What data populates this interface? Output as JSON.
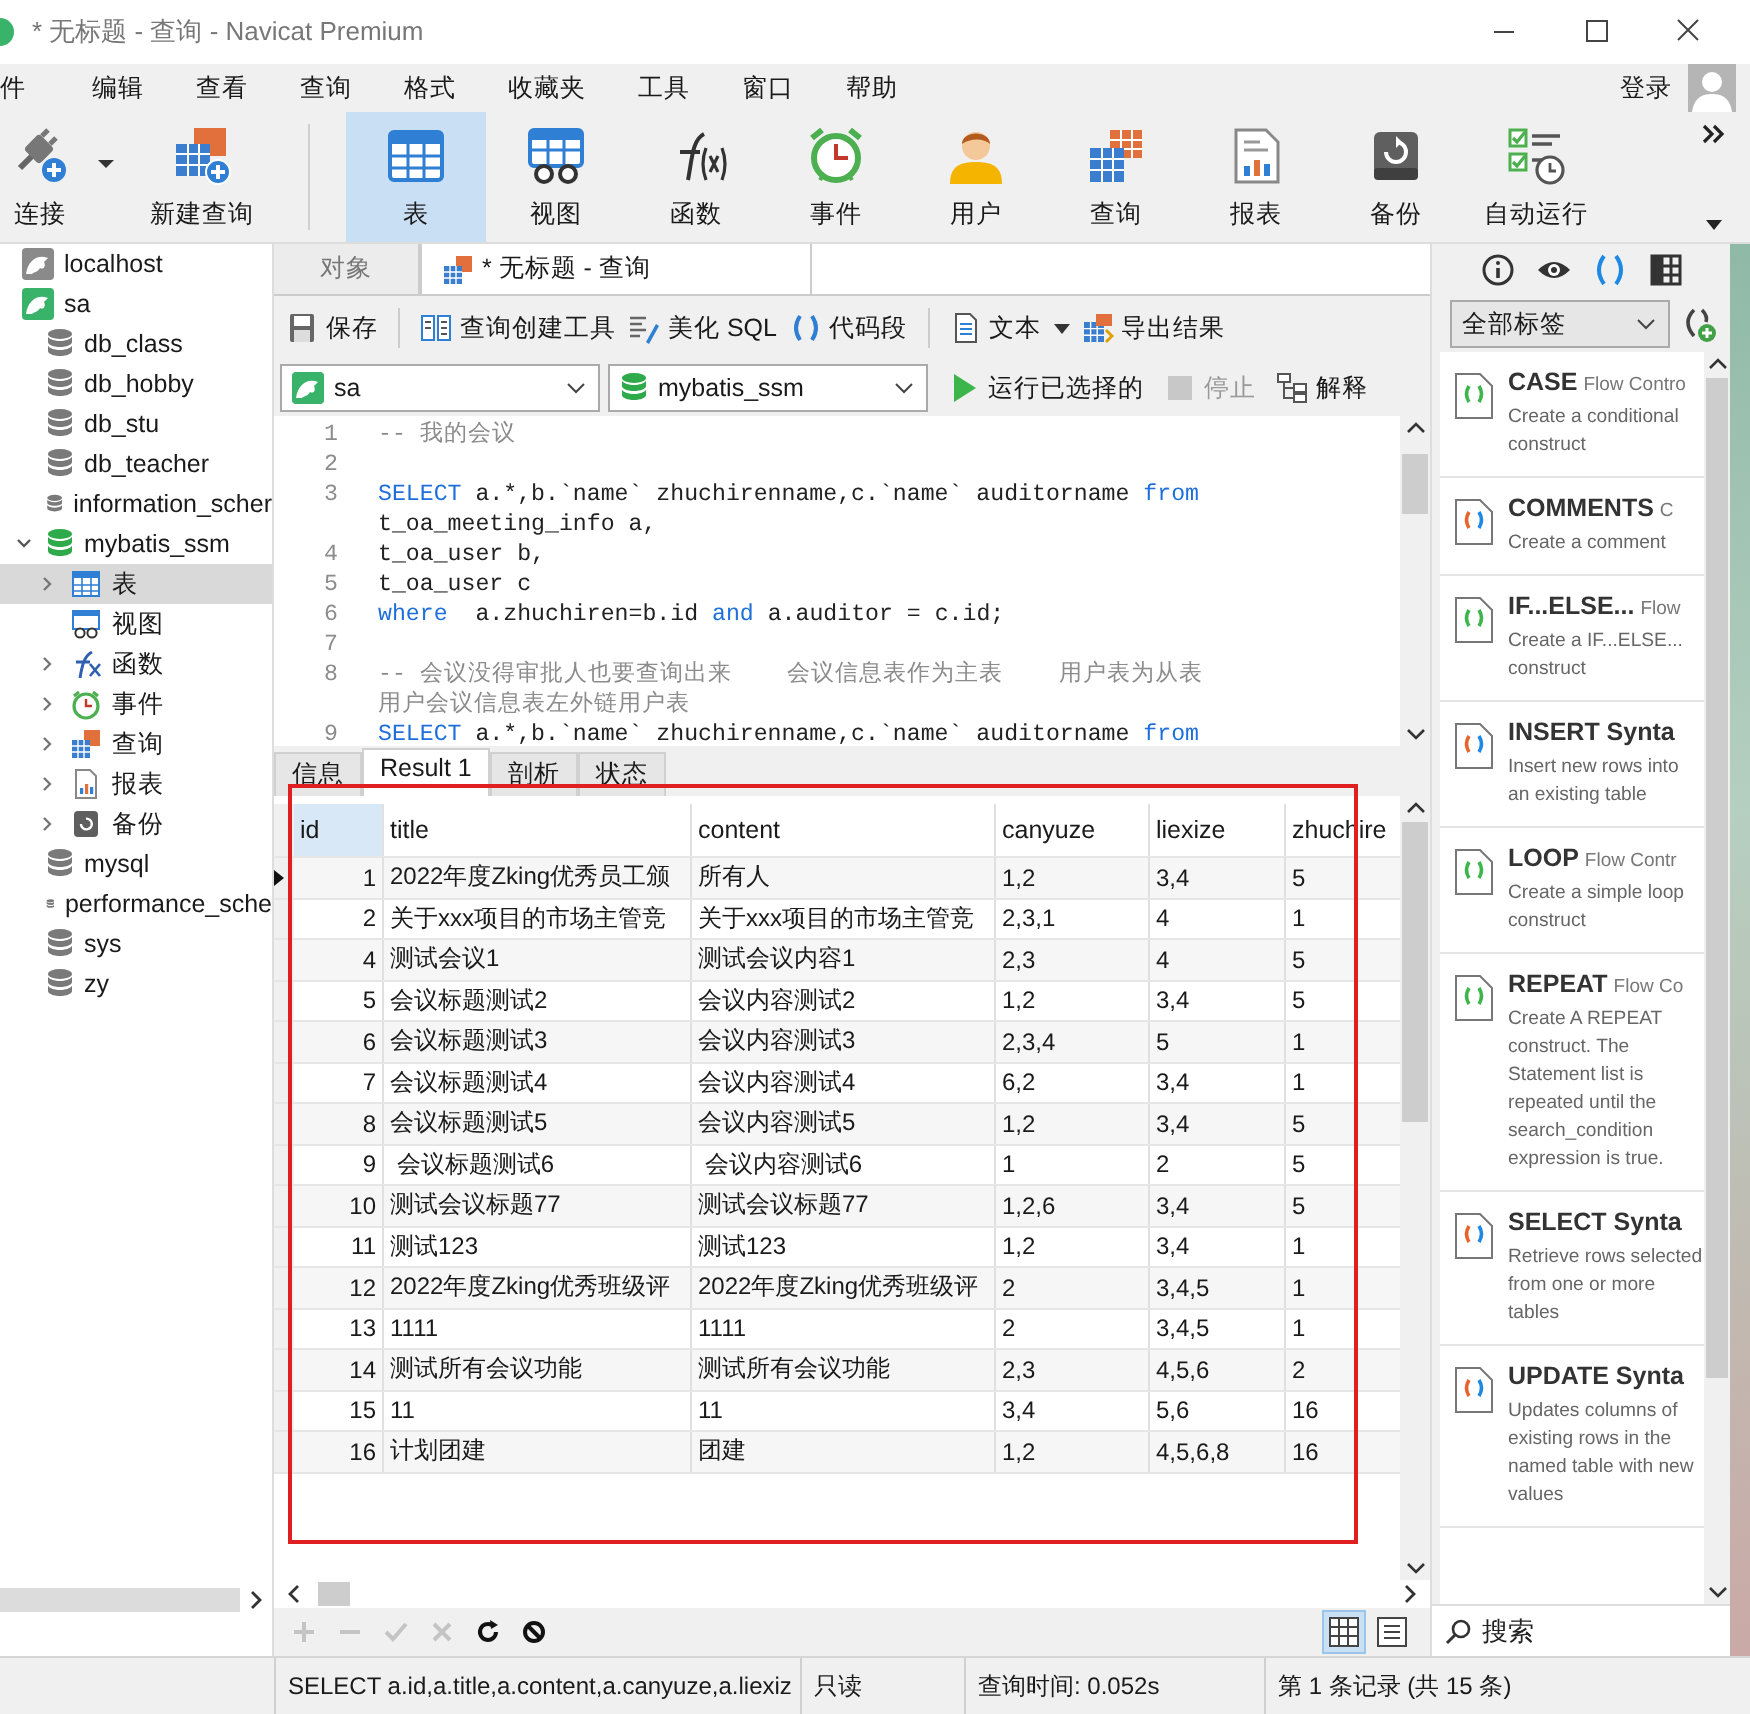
{
  "window": {
    "title": "* 无标题 - 查询 - Navicat Premium"
  },
  "menu": {
    "items": [
      "件",
      "编辑",
      "查看",
      "查询",
      "格式",
      "收藏夹",
      "工具",
      "窗口",
      "帮助"
    ],
    "login": "登录"
  },
  "toolbar": [
    {
      "kind": "connect",
      "label": "连接",
      "selected": false
    },
    {
      "kind": "newquery",
      "label": "新建查询",
      "selected": false
    },
    {
      "kind": "table",
      "label": "表",
      "selected": true
    },
    {
      "kind": "view",
      "label": "视图",
      "selected": false
    },
    {
      "kind": "function",
      "label": "函数",
      "selected": false
    },
    {
      "kind": "event",
      "label": "事件",
      "selected": false
    },
    {
      "kind": "user",
      "label": "用户",
      "selected": false
    },
    {
      "kind": "query",
      "label": "查询",
      "selected": false
    },
    {
      "kind": "report",
      "label": "报表",
      "selected": false
    },
    {
      "kind": "backup",
      "label": "备份",
      "selected": false
    },
    {
      "kind": "autorun",
      "label": "自动运行",
      "selected": false
    }
  ],
  "sidebar": {
    "tree": [
      {
        "kind": "connection",
        "label": "localhost",
        "open": false,
        "selected": false
      },
      {
        "kind": "connection",
        "label": "sa",
        "open": true,
        "selected": false,
        "children": [
          {
            "kind": "database",
            "label": "db_class",
            "open": false,
            "selected": false
          },
          {
            "kind": "database",
            "label": "db_hobby",
            "open": false,
            "selected": false
          },
          {
            "kind": "database",
            "label": "db_stu",
            "open": false,
            "selected": false
          },
          {
            "kind": "database",
            "label": "db_teacher",
            "open": false,
            "selected": false
          },
          {
            "kind": "database",
            "label": "information_scher",
            "open": false,
            "selected": false
          },
          {
            "kind": "database",
            "label": "mybatis_ssm",
            "open": true,
            "expanded": true,
            "selected": false,
            "children": [
              {
                "kind": "table",
                "label": "表",
                "expanded": false,
                "selected": true
              },
              {
                "kind": "view",
                "label": "视图",
                "selected": false
              },
              {
                "kind": "function",
                "label": "函数",
                "expanded": false,
                "selected": false
              },
              {
                "kind": "event",
                "label": "事件",
                "expanded": false,
                "selected": false
              },
              {
                "kind": "query",
                "label": "查询",
                "expanded": false,
                "selected": false
              },
              {
                "kind": "report",
                "label": "报表",
                "expanded": false,
                "selected": false
              },
              {
                "kind": "backup",
                "label": "备份",
                "expanded": false,
                "selected": false
              }
            ]
          },
          {
            "kind": "database",
            "label": "mysql",
            "open": false,
            "selected": false
          },
          {
            "kind": "database",
            "label": "performance_sche",
            "open": false,
            "selected": false
          },
          {
            "kind": "database",
            "label": "sys",
            "open": false,
            "selected": false
          },
          {
            "kind": "database",
            "label": "zy",
            "open": false,
            "selected": false
          }
        ]
      }
    ]
  },
  "tabs": [
    {
      "label": "对象",
      "kind": "objects",
      "selected": false
    },
    {
      "label": "* 无标题 - 查询",
      "kind": "query",
      "selected": true
    }
  ],
  "editor_toolbar": [
    [
      {
        "kind": "save",
        "label": "保存"
      }
    ],
    [
      {
        "kind": "builder",
        "label": "查询创建工具"
      },
      {
        "kind": "beautify",
        "label": "美化 SQL"
      },
      {
        "kind": "snippet",
        "label": "代码段"
      }
    ],
    [
      {
        "kind": "text",
        "label": "文本"
      },
      {
        "kind": "export",
        "label": "导出结果"
      }
    ]
  ],
  "run_bar": {
    "connection": "sa",
    "database": "mybatis_ssm",
    "actions": [
      {
        "kind": "run",
        "label": "运行已选择的",
        "disabled": false
      },
      {
        "kind": "stop",
        "label": "停止",
        "disabled": true
      },
      {
        "kind": "explain",
        "label": "解释",
        "disabled": false
      }
    ]
  },
  "editor": {
    "lines": [
      {
        "number": "1",
        "tokens": [
          {
            "kind": "comment",
            "text": "-- 我的会议"
          }
        ]
      },
      {
        "number": "2"
      },
      {
        "number": "3",
        "tokens": [
          {
            "kind": "keyword",
            "text": "SELECT"
          },
          {
            "kind": "plain",
            "text": " a.*,b.`name` zhuchirenname,c.`name` auditorname "
          },
          {
            "kind": "keyword",
            "text": "from"
          },
          {
            "kind": "plain",
            "text": " t_oa_meeting_info a,"
          }
        ]
      },
      {
        "number": "4",
        "tokens": [
          {
            "kind": "plain",
            "text": "t_oa_user b,"
          }
        ]
      },
      {
        "number": "5",
        "tokens": [
          {
            "kind": "plain",
            "text": "t_oa_user c"
          }
        ]
      },
      {
        "number": "6",
        "tokens": [
          {
            "kind": "keyword",
            "text": "where"
          },
          {
            "kind": "plain",
            "text": "  a.zhuchiren=b.id "
          },
          {
            "kind": "keyword",
            "text": "and"
          },
          {
            "kind": "plain",
            "text": " a.auditor = c.id;"
          }
        ]
      },
      {
        "number": "7"
      },
      {
        "number": "8",
        "tokens": [
          {
            "kind": "comment",
            "text": "-- 会议没得审批人也要查询出来    会议信息表作为主表    用户表为从表"
          },
          {
            "kind": "break"
          },
          {
            "kind": "comment",
            "text": "用户会议信息表左外链用户表"
          }
        ]
      },
      {
        "number": "9",
        "tokens": [
          {
            "kind": "keyword",
            "text": "SELECT"
          },
          {
            "kind": "plain",
            "text": " a.*,b.`name` zhuchirenname,c.`name` auditorname "
          },
          {
            "kind": "keyword",
            "text": "from"
          }
        ]
      }
    ]
  },
  "result_tabs": [
    {
      "label": "信息",
      "selected": false
    },
    {
      "label": "Result 1",
      "selected": true
    },
    {
      "label": "剖析",
      "selected": false
    },
    {
      "label": "状态",
      "selected": false
    }
  ],
  "grid": {
    "highlight_box": true,
    "columns": [
      {
        "label": "id",
        "selected": true
      },
      {
        "label": "title",
        "selected": false
      },
      {
        "label": "content",
        "selected": false
      },
      {
        "label": "canyuze",
        "selected": false
      },
      {
        "label": "liexize",
        "selected": false
      },
      {
        "label": "zhuchire",
        "selected": false
      }
    ],
    "rows": [
      {
        "current": true,
        "cells": [
          "1",
          "2022年度Zking优秀员工颁",
          "所有人",
          "1,2",
          "3,4",
          "5"
        ]
      },
      {
        "current": false,
        "cells": [
          "2",
          "关于xxx项目的市场主管竞",
          "关于xxx项目的市场主管竞",
          "2,3,1",
          "4",
          "1"
        ]
      },
      {
        "current": false,
        "cells": [
          "4",
          "测试会议1",
          "测试会议内容1",
          "2,3",
          "4",
          "5"
        ]
      },
      {
        "current": false,
        "cells": [
          "5",
          "会议标题测试2",
          "会议内容测试2",
          "1,2",
          "3,4",
          "5"
        ]
      },
      {
        "current": false,
        "cells": [
          "6",
          "会议标题测试3",
          "会议内容测试3",
          "2,3,4",
          "5",
          "1"
        ]
      },
      {
        "current": false,
        "cells": [
          "7",
          "会议标题测试4",
          "会议内容测试4",
          "6,2",
          "3,4",
          "1"
        ]
      },
      {
        "current": false,
        "cells": [
          "8",
          "会议标题测试5",
          "会议内容测试5",
          "1,2",
          "3,4",
          "5"
        ]
      },
      {
        "current": false,
        "cells": [
          "9",
          " 会议标题测试6",
          " 会议内容测试6",
          "1",
          "2",
          "5"
        ]
      },
      {
        "current": false,
        "cells": [
          "10",
          "测试会议标题77",
          "测试会议标题77",
          "1,2,6",
          "3,4",
          "5"
        ]
      },
      {
        "current": false,
        "cells": [
          "11",
          "测试123",
          "测试123",
          "1,2",
          "3,4",
          "1"
        ]
      },
      {
        "current": false,
        "cells": [
          "12",
          "2022年度Zking优秀班级评",
          "2022年度Zking优秀班级评",
          "2",
          "3,4,5",
          "1"
        ]
      },
      {
        "current": false,
        "cells": [
          "13",
          "1111",
          "1111",
          "2",
          "3,4,5",
          "1"
        ]
      },
      {
        "current": false,
        "cells": [
          "14",
          "测试所有会议功能",
          "测试所有会议功能",
          "2,3",
          "4,5,6",
          "2"
        ]
      },
      {
        "current": false,
        "cells": [
          "15",
          "11",
          "11",
          "3,4",
          "5,6",
          "16"
        ]
      },
      {
        "current": false,
        "cells": [
          "16",
          "计划团建",
          "团建",
          "1,2",
          "4,5,6,8",
          "16"
        ]
      }
    ]
  },
  "grid_toolbar": [
    {
      "kind": "add",
      "disabled": true
    },
    {
      "kind": "remove",
      "disabled": true
    },
    {
      "kind": "apply",
      "disabled": true
    },
    {
      "kind": "discard",
      "disabled": true
    },
    {
      "kind": "refresh",
      "disabled": false
    },
    {
      "kind": "stop",
      "disabled": false
    }
  ],
  "grid_views": [
    {
      "kind": "grid",
      "selected": true
    },
    {
      "kind": "form",
      "selected": false
    }
  ],
  "right_panel": {
    "tabs": [
      {
        "kind": "info",
        "selected": false
      },
      {
        "kind": "preview",
        "selected": false
      },
      {
        "kind": "snippets",
        "selected": true
      },
      {
        "kind": "grid",
        "selected": false
      }
    ],
    "filter": "全部标签",
    "snippets": [
      {
        "kind": "flow",
        "title": "CASE",
        "category": "Flow Contro",
        "description": "Create a conditional construct"
      },
      {
        "kind": "syntax",
        "title": "COMMENTS",
        "category": "C",
        "description": "Create a comment"
      },
      {
        "kind": "flow",
        "title": "IF...ELSE...",
        "category": "Flow",
        "description": "Create a IF...ELSE... construct"
      },
      {
        "kind": "syntax",
        "title": "INSERT Synta",
        "description": "Insert new rows into an existing table"
      },
      {
        "kind": "flow",
        "title": "LOOP",
        "category": "Flow Contr",
        "description": "Create a simple loop construct"
      },
      {
        "kind": "flow",
        "title": "REPEAT",
        "category": "Flow Co",
        "description": "Create A REPEAT construct. The Statement list is repeated until the search_condition expression is true."
      },
      {
        "kind": "syntax",
        "title": "SELECT Synta",
        "description": "Retrieve rows selected from one or more tables"
      },
      {
        "kind": "syntax",
        "title": "UPDATE Synta",
        "description": "Updates columns of existing rows in the named table with new values"
      }
    ],
    "search": {
      "placeholder": "搜索"
    }
  },
  "status_bar": {
    "sql": "SELECT a.id,a.title,a.content,a.canyuze,a.liexiz",
    "mode": "只读",
    "time": "查询时间: 0.052s",
    "record": "第 1 条记录 (共 15 条)"
  }
}
